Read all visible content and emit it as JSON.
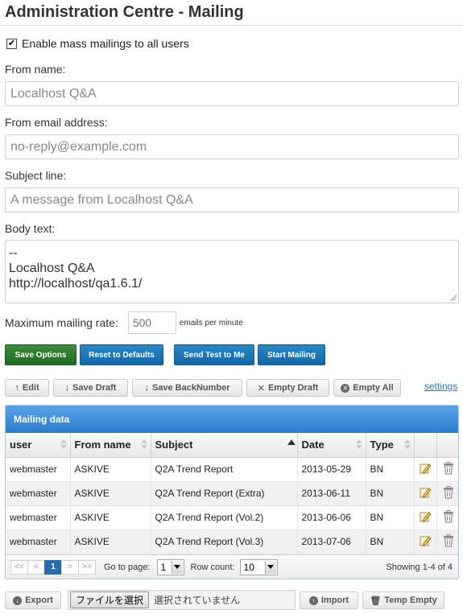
{
  "page": {
    "title": "Administration Centre - Mailing"
  },
  "form": {
    "enable_label": "Enable mass mailings to all users",
    "enable_checked": true,
    "from_name_label": "From name:",
    "from_name_value": "Localhost Q&A",
    "from_email_label": "From email address:",
    "from_email_value": "no-reply@example.com",
    "subject_label": "Subject line:",
    "subject_value": "A message from Localhost Q&A",
    "body_label": "Body text:",
    "body_lines": [
      "--",
      "Localhost Q&A",
      "http://localhost/qa1.6.1/"
    ],
    "rate_label": "Maximum mailing rate:",
    "rate_value": "500",
    "rate_unit": "emails per minute"
  },
  "actions": {
    "save_options": "Save Options",
    "reset_defaults": "Reset to Defaults",
    "send_test": "Send Test to Me",
    "start_mailing": "Start Mailing"
  },
  "toolbar": {
    "edit": "Edit",
    "save_draft": "Save Draft",
    "save_backnumber": "Save BackNumber",
    "empty_draft": "Empty Draft",
    "empty_all": "Empty All",
    "settings_link": "settings"
  },
  "grid": {
    "caption": "Mailing data",
    "columns": [
      "user",
      "From name",
      "Subject",
      "Date",
      "Type"
    ],
    "sorted_column": "Subject",
    "rows": [
      {
        "user": "webmaster",
        "from_name": "ASKIVE",
        "subject": "Q2A Trend Report",
        "date": "2013-05-29",
        "type": "BN"
      },
      {
        "user": "webmaster",
        "from_name": "ASKIVE",
        "subject": "Q2A Trend Report (Extra)",
        "date": "2013-06-11",
        "type": "BN"
      },
      {
        "user": "webmaster",
        "from_name": "ASKIVE",
        "subject": "Q2A Trend Report (Vol.2)",
        "date": "2013-06-06",
        "type": "BN"
      },
      {
        "user": "webmaster",
        "from_name": "ASKIVE",
        "subject": "Q2A Trend Report (Vol.3)",
        "date": "2013-07-06",
        "type": "BN"
      }
    ],
    "pager": {
      "first": "<<",
      "prev": "<",
      "current": "1",
      "next": ">",
      "last": ">>",
      "goto_label": "Go to page:",
      "goto_value": "1",
      "rowcount_label": "Row count:",
      "rowcount_value": "10",
      "showing": "Showing 1-4 of 4"
    }
  },
  "bottom": {
    "export": "Export",
    "file_button": "ファイルを選択",
    "file_status": "選択されていません",
    "import": "Import",
    "temp_empty": "Temp Empty"
  },
  "colors": {
    "save_green": "#2a7a2a",
    "action_blue": "#1672b6",
    "grid_header_blue": "#3b8ad8",
    "link_blue": "#2b76c0",
    "pager_current": "#2a6bb0"
  }
}
